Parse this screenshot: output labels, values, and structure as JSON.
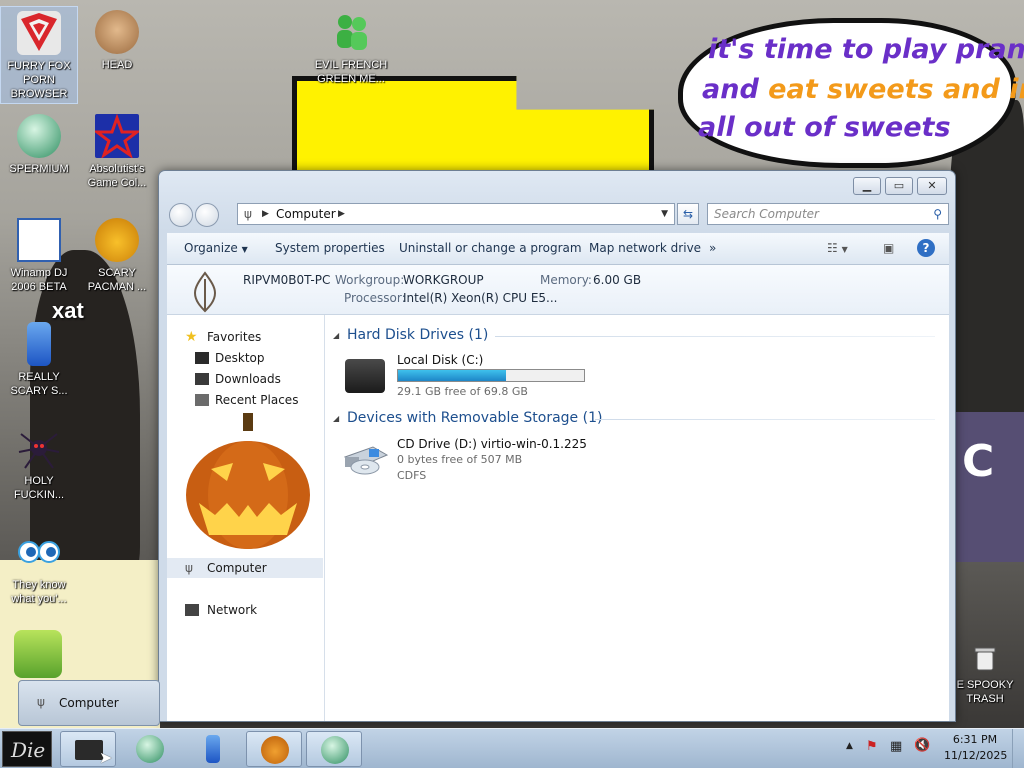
{
  "desktop": {
    "prank_text": {
      "line1": "it's time to play pranks",
      "line2_start": "and ",
      "line2_orange": "eat sweets and im",
      "line3": "all out of sweets"
    },
    "icons": [
      {
        "label": "FURRY FOX PORN BROWSER"
      },
      {
        "label": "HEAD"
      },
      {
        "label": "EVIL FRENCH GREEN ME..."
      },
      {
        "label": "SPERMIUM"
      },
      {
        "label": "Absolutist's Game Col..."
      },
      {
        "label": "Winamp DJ 2006 BETA"
      },
      {
        "label": "SCARY PACMAN ..."
      },
      {
        "label": "REALLY SCARY S..."
      },
      {
        "label": "HOLY FUCKIN..."
      },
      {
        "label": "They know what you'..."
      },
      {
        "label": "E SPOOKY TRASH"
      }
    ],
    "xat_text": "xat",
    "deco_letter": "C"
  },
  "window": {
    "address_path": "Computer",
    "search_placeholder": "Search Computer",
    "toolbar": {
      "organize": "Organize",
      "system_properties": "System properties",
      "uninstall": "Uninstall or change a program",
      "map_drive": "Map network drive",
      "more": "»"
    },
    "details": {
      "pc_name": "RIPVM0B0T-PC",
      "workgroup_label": "Workgroup:",
      "workgroup_value": "WORKGROUP",
      "memory_label": "Memory:",
      "memory_value": "6.00 GB",
      "processor_label": "Processor:",
      "processor_value": "Intel(R) Xeon(R) CPU E5..."
    },
    "nav": {
      "favorites": "Favorites",
      "desktop": "Desktop",
      "downloads": "Downloads",
      "recent_places": "Recent Places",
      "computer": "Computer",
      "network": "Network"
    },
    "groups": {
      "hard_disk": "Hard Disk Drives (1)",
      "removable": "Devices with Removable Storage (1)"
    },
    "drives": {
      "local_name": "Local Disk (C:)",
      "local_free": "29.1 GB free of 69.8 GB",
      "local_used_fraction": 0.583,
      "cd_name": "CD Drive (D:) virtio-win-0.1.225",
      "cd_free": "0 bytes free of 507 MB",
      "cd_fs": "CDFS"
    }
  },
  "flyout": {
    "label": "Computer"
  },
  "taskbar": {
    "start_label": "Die",
    "clock_time": "6:31 PM",
    "clock_date": "11/12/2025"
  },
  "colors": {
    "prank_purple": "#6a2fc8",
    "prank_orange": "#f39a1a",
    "capacity_blue": "#1e86c7",
    "group_header_blue": "#1d4f8e"
  }
}
